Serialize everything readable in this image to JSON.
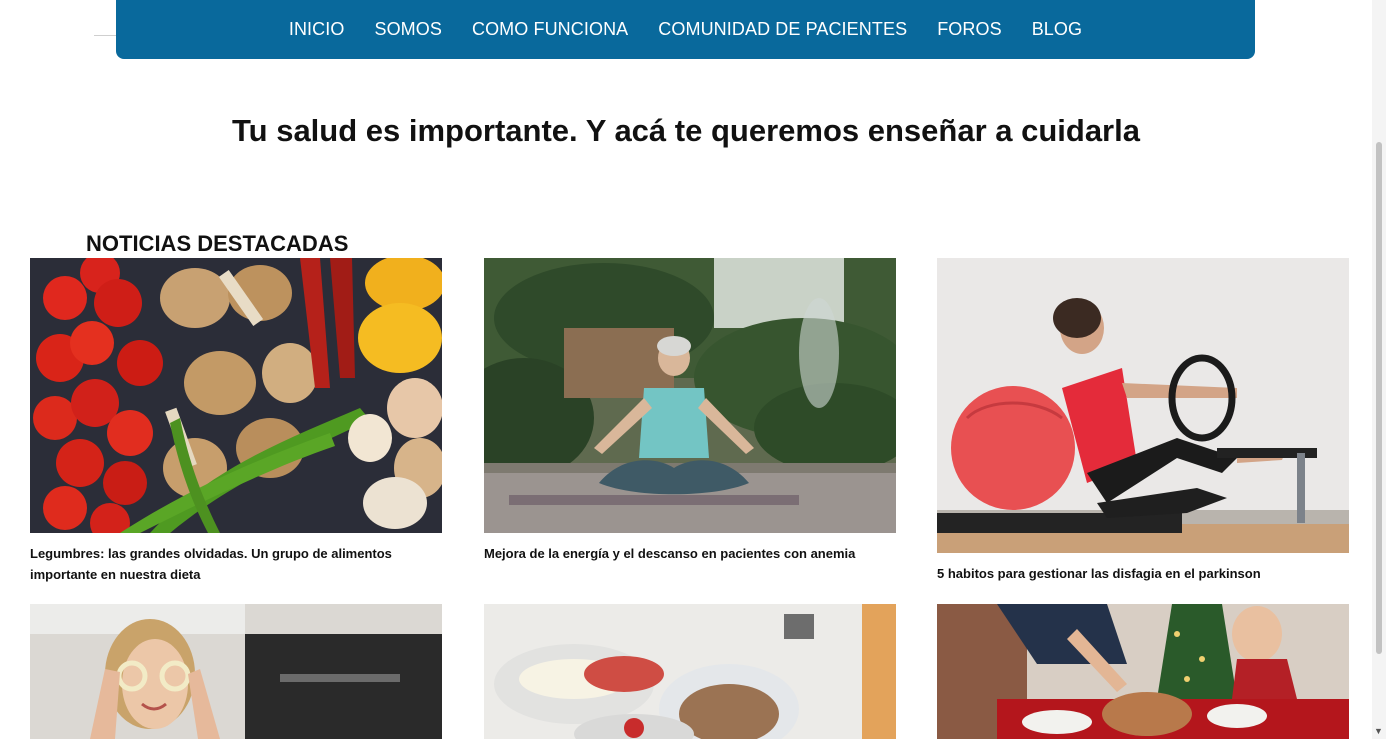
{
  "nav": {
    "items": [
      "INICIO",
      "SOMOS",
      "COMO FUNCIONA",
      "COMUNIDAD DE PACIENTES",
      "FOROS",
      "BLOG"
    ]
  },
  "hero": {
    "title": "Tu salud es importante. Y acá te queremos enseñar a cuidarla"
  },
  "section": {
    "title": "NOTICIAS DESTACADAS"
  },
  "articles": [
    {
      "title": "Legumbres: las grandes olvidadas. Un grupo de alimentos importante en nuestra dieta",
      "image": "vegetables-photo"
    },
    {
      "title": "Mejora de la energía y el descanso en pacientes con anemia",
      "image": "meditation-photo"
    },
    {
      "title": "5 habitos para gestionar las disfagia en el parkinson",
      "image": "pilates-photo"
    },
    {
      "title": "",
      "image": "woman-onion-rings-photo"
    },
    {
      "title": "",
      "image": "breakfast-table-photo"
    },
    {
      "title": "",
      "image": "christmas-dinner-photo"
    }
  ],
  "colors": {
    "nav_bg": "#09699c",
    "nav_text": "#ffffff"
  }
}
